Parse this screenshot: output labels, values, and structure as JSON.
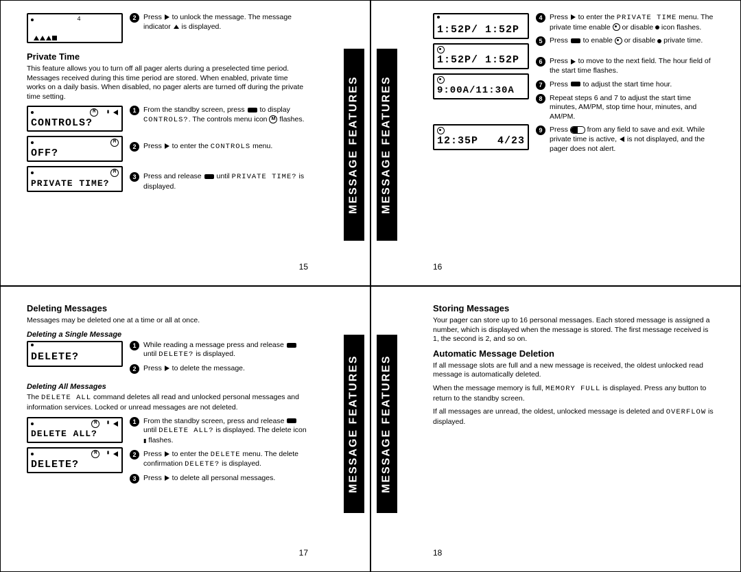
{
  "tab_label": "MESSAGE FEATURES",
  "p15": {
    "pagenum": "15",
    "lcd1_top": "4",
    "title": "Private Time",
    "desc": "This feature allows you to turn off all pager alerts during a preselected time period. Messages received during this time period are stored. When enabled, private time works on a daily basis. When disabled, no pager alerts are turned off during the private time setting.",
    "lcd_controls": "CONTROLS?",
    "lcd_off": "OFF?",
    "lcd_pt": "PRIVATE TIME?",
    "s1a": "From the standby screen, press ",
    "s1b": " to display ",
    "s1c": ". The controls menu icon ",
    "s1d": " flashes.",
    "s2a": "Press ",
    "s2b": " to enter the ",
    "s2c": " menu.",
    "ctrl_word": "CONTROLS",
    "ctrl_word_q": "CONTROLS?",
    "s3a": "Press and release ",
    "s3b": " until ",
    "s3c": " is displayed.",
    "pt_word": "PRIVATE TIME?",
    "top2a": "Press ",
    "top2b": " to unlock the message. The message indicator ",
    "top2c": " is displayed."
  },
  "p16": {
    "pagenum": "16",
    "lcd1": "1:52P/ 1:52P",
    "lcd2": "1:52P/ 1:52P",
    "lcd3": "9:00A/11:30A",
    "lcd4a": "12:35P",
    "lcd4b": "4/23",
    "s4a": "Press ",
    "s4b": " to enter the ",
    "s4c": " menu. The private time enable ",
    "s4d": " or disable ",
    "s4e": " icon flashes.",
    "pt_word": "PRIVATE TIME",
    "s5a": "Press ",
    "s5b": " to enable ",
    "s5c": " or disable ",
    "s5d": " private time.",
    "s6a": "Press ",
    "s6b": " to move to the next field. The hour field of the start time flashes.",
    "s7a": "Press ",
    "s7b": " to adjust the start time hour.",
    "s8": "Repeat steps 6 and 7 to adjust the start time minutes, AM/PM, stop time hour, minutes, and AM/PM.",
    "s9a": "Press ",
    "s9b": " from any field to save and exit. While private time is active, ",
    "s9c": " is not displayed, and the pager does not alert."
  },
  "p17": {
    "pagenum": "17",
    "h1": "Deleting Messages",
    "p1": "Messages may be deleted one at a time or all at once.",
    "h2": "Deleting a Single Message",
    "lcd_del": "DELETE?",
    "s1a": "While reading a message press and release ",
    "s1b": " until ",
    "s1c": " is displayed.",
    "del_word": "DELETE?",
    "s2a": "Press ",
    "s2b": " to delete the message.",
    "h3": "Deleting All Messages",
    "p2a": "The ",
    "p2b": " command deletes all read and unlocked personal messages and information services. Locked or unread messages are not deleted.",
    "delall_word": "DELETE ALL",
    "lcd_delall": "DELETE ALL?",
    "lcd_del2": "DELETE?",
    "s3a": "From the standby screen, press and release ",
    "s3b": " until ",
    "s3c": " is displayed. The delete icon ",
    "s3d": " flashes.",
    "delall_wordq": "DELETE ALL?",
    "s4a": "Press ",
    "s4b": " to enter the ",
    "s4c": " menu. The delete confirmation ",
    "s4d": " is displayed.",
    "del_menu": "DELETE",
    "s5a": "Press ",
    "s5b": " to delete all personal messages."
  },
  "p18": {
    "pagenum": "18",
    "h1": "Storing Messages",
    "p1": "Your pager can store up to 16 personal messages. Each stored message is assigned a number, which is displayed when the message is stored. The first message received is 1, the second is 2, and so on.",
    "h2": "Automatic Message Deletion",
    "p2": "If all message slots are full and a new message is received, the oldest unlocked read message is automatically deleted.",
    "p3a": "When the message memory is full, ",
    "p3b": " is displayed. Press any button to return to the standby screen.",
    "memfull": "MEMORY FULL",
    "p4a": "If all messages are unread, the oldest, unlocked message is deleted and ",
    "p4b": " is displayed.",
    "overflow": "OVERFLOW"
  }
}
